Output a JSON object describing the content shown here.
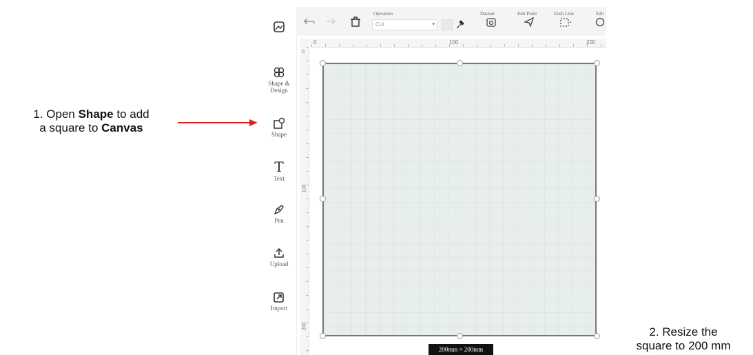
{
  "annotations": {
    "step1": {
      "prefix": "1. Open ",
      "bold1": "Shape",
      "middle": " to add",
      "line2_prefix": "a square to ",
      "bold2": "Canvas"
    },
    "step2": {
      "line1": "2. Resize the",
      "line2": "square to 200 mm"
    },
    "arrow_color": "#e02020",
    "marker": "4"
  },
  "toolbar": {
    "operation_label": "Operation",
    "operation_value": "Cut",
    "items": [
      "Dataset",
      "Edit Point",
      "Dash Line",
      "Edit"
    ]
  },
  "sidebar": {
    "items": [
      {
        "label": "",
        "icon": "image-icon"
      },
      {
        "label": "Shape & Design",
        "icon": "design-icon"
      },
      {
        "label": "Shape",
        "icon": "shape-icon"
      },
      {
        "label": "Text",
        "icon": "text-icon"
      },
      {
        "label": "Pen",
        "icon": "pen-icon"
      },
      {
        "label": "Upload",
        "icon": "upload-icon"
      },
      {
        "label": "Import",
        "icon": "import-icon"
      }
    ]
  },
  "ruler": {
    "h_ticks": [
      "0",
      "100",
      "200"
    ],
    "v_ticks": [
      "0",
      "100",
      "200"
    ]
  },
  "canvas": {
    "size_readout": "200mm × 200mm"
  }
}
